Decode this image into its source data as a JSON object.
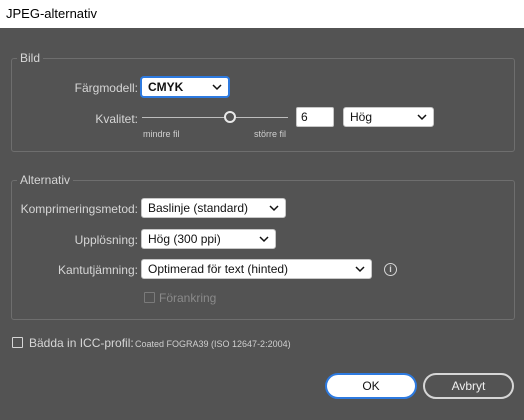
{
  "window": {
    "title": "JPEG-alternativ"
  },
  "image_group": {
    "label": "Bild",
    "color_model": {
      "label": "Färgmodell:",
      "value": "CMYK"
    },
    "quality": {
      "label": "Kvalitet:",
      "slider_value": 6,
      "value": "6",
      "min_label": "mindre fil",
      "max_label": "större fil",
      "preset": "Hög"
    }
  },
  "options_group": {
    "label": "Alternativ",
    "compression": {
      "label": "Komprimeringsmetod:",
      "value": "Baslinje (standard)"
    },
    "resolution": {
      "label": "Upplösning:",
      "value": "Hög (300 ppi)"
    },
    "antialiasing": {
      "label": "Kantutjämning:",
      "value": "Optimerad för text (hinted)"
    },
    "anchoring": {
      "label": "Förankring",
      "checked": false,
      "disabled": true
    }
  },
  "icc_profile": {
    "label": "Bädda in ICC-profil:",
    "profile_name": "Coated FOGRA39 (ISO 12647-2:2004)",
    "checked": false
  },
  "buttons": {
    "ok": "OK",
    "cancel": "Avbryt"
  },
  "icons": {
    "dropdown": "chevron-down-icon",
    "info": "info-icon"
  },
  "colors": {
    "dialog_background": "#535353",
    "accent": "#2d7ae0"
  }
}
